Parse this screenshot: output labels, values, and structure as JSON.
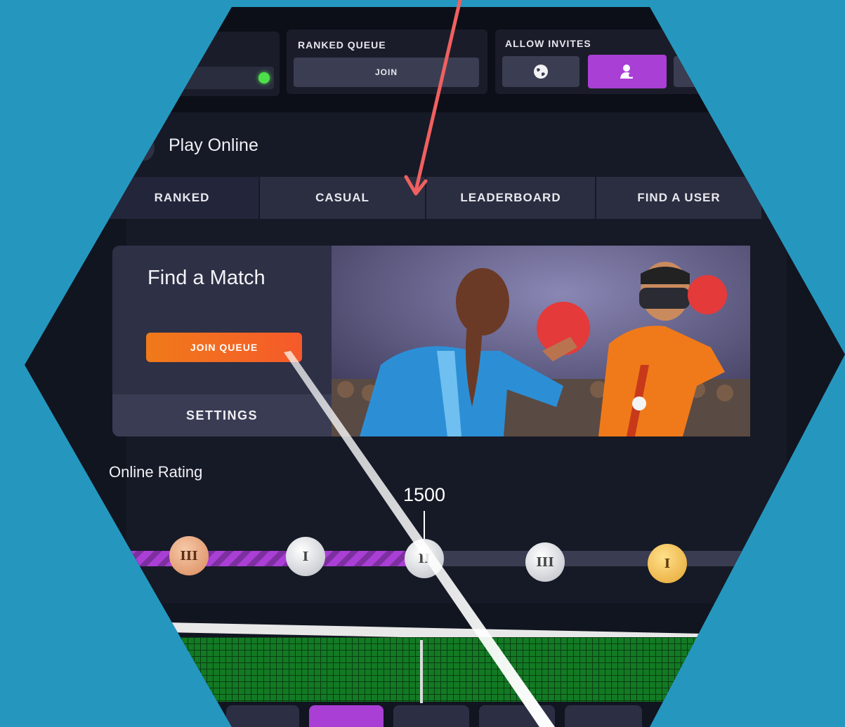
{
  "top_bar": {
    "ranked_queue_label": "RANKED QUEUE",
    "join_label": "JOIN",
    "allow_invites_label": "ALLOW INVITES",
    "status_color": "#4ee04a"
  },
  "header": {
    "title": "Play Online"
  },
  "tabs": [
    {
      "label": "RANKED",
      "active": true
    },
    {
      "label": "CASUAL",
      "active": false
    },
    {
      "label": "LEADERBOARD",
      "active": false
    },
    {
      "label": "FIND A USER",
      "active": false
    }
  ],
  "match_card": {
    "title": "Find a Match",
    "join_queue_label": "JOIN QUEUE",
    "settings_label": "SETTINGS"
  },
  "rating": {
    "title": "Online Rating",
    "value": "1500",
    "medals": [
      {
        "tier": "bronze",
        "rank": "III"
      },
      {
        "tier": "silver",
        "rank": "I"
      },
      {
        "tier": "silver",
        "rank": "II"
      },
      {
        "tier": "silver",
        "rank": "III"
      },
      {
        "tier": "gold",
        "rank": "I"
      }
    ]
  },
  "colors": {
    "accent_purple": "#a93fd4",
    "accent_orange": "#f07a1a",
    "annotation_arrow": "#f06060"
  }
}
